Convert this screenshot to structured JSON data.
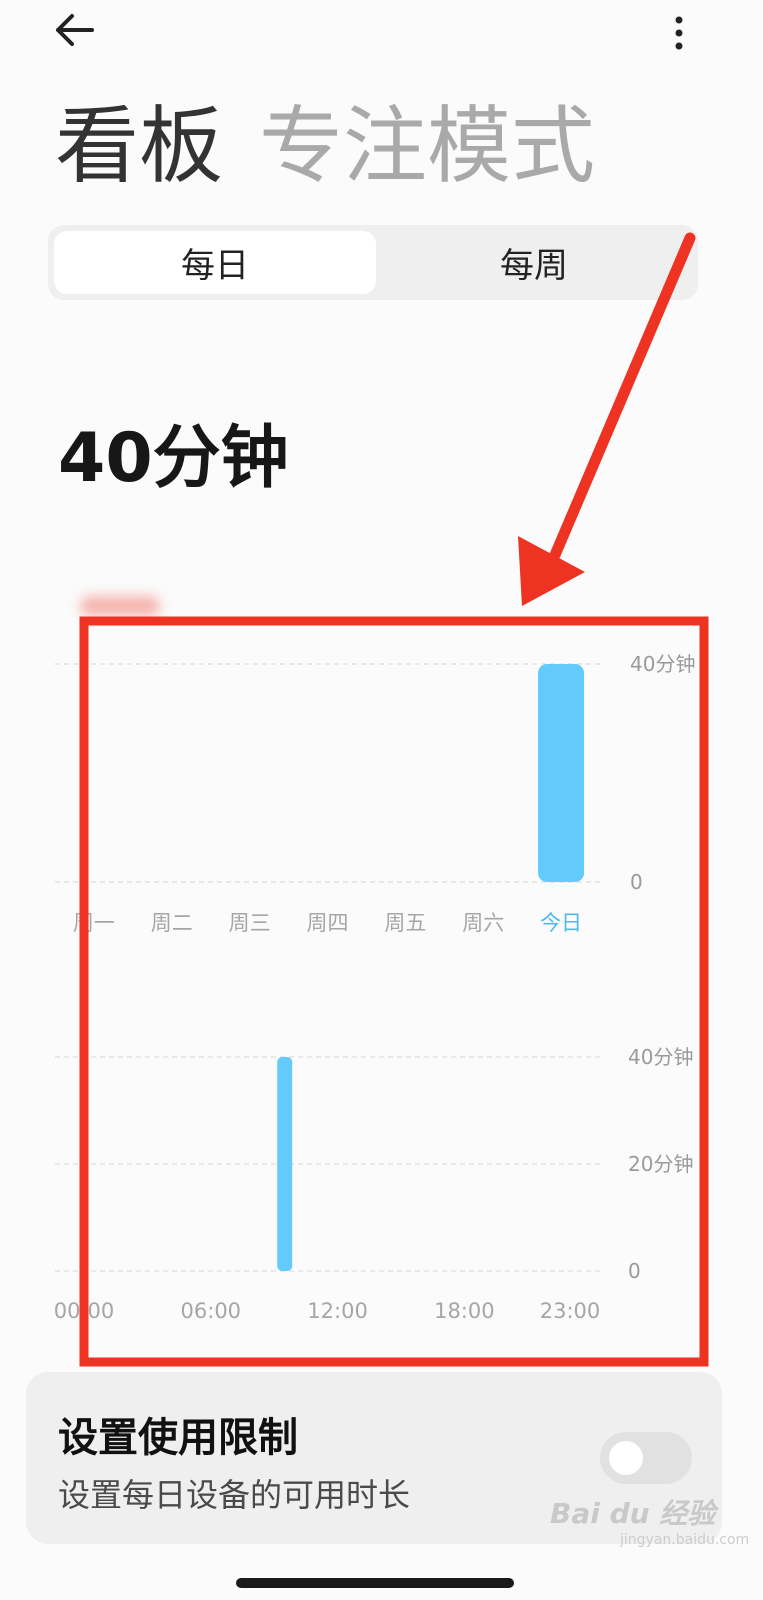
{
  "nav": {
    "back_icon": "arrow-left-icon",
    "more_icon": "more-vertical-icon"
  },
  "header_tabs": [
    {
      "label": "看板",
      "active": true
    },
    {
      "label": "专注模式",
      "active": false
    }
  ],
  "segment": {
    "day_label": "每日",
    "week_label": "每周",
    "selected": "每日"
  },
  "summary": {
    "total": "40分钟"
  },
  "chart_data": [
    {
      "type": "bar",
      "categories": [
        "周一",
        "周二",
        "周三",
        "周四",
        "周五",
        "周六",
        "今日"
      ],
      "values": [
        0,
        0,
        0,
        0,
        0,
        0,
        40
      ],
      "y_tick_labels": [
        "40分钟",
        "0"
      ],
      "ylim": [
        0,
        40
      ],
      "highlight_category": "今日",
      "bar_color": "#62cbfb",
      "highlight_color": "#4fb8ea",
      "grid": true
    },
    {
      "type": "bar",
      "x_tick_labels": [
        "00:00",
        "06:00",
        "12:00",
        "18:00",
        "23:00"
      ],
      "bars": [
        {
          "x_hour": 9.5,
          "value": 40
        }
      ],
      "y_tick_labels": [
        "40分钟",
        "20分钟",
        "0"
      ],
      "ylim": [
        0,
        40
      ],
      "xlim": [
        0,
        23
      ],
      "bar_color": "#62cbfb",
      "grid": true
    }
  ],
  "annotation": {
    "color": "#ee3322"
  },
  "limit_card": {
    "title": "设置使用限制",
    "subtitle": "设置每日设备的可用时长",
    "toggle_on": false
  },
  "watermark": {
    "text": "Bai du 经验",
    "sub": "jingyan.baidu.com"
  }
}
